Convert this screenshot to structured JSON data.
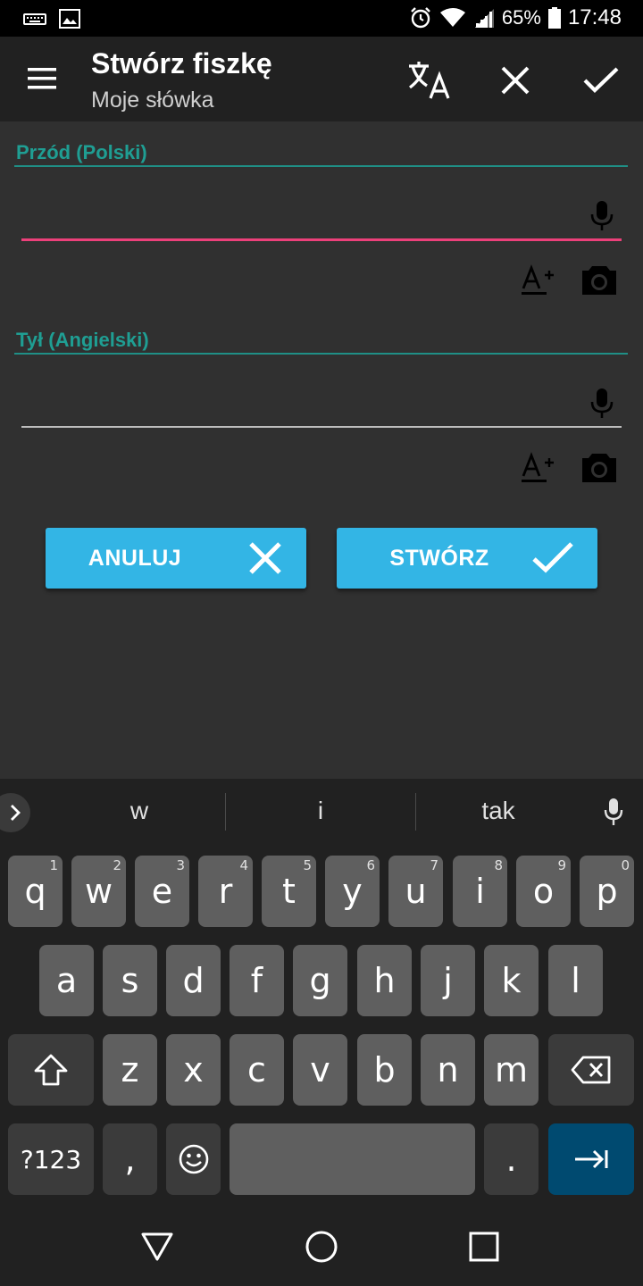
{
  "status_bar": {
    "battery": "65%",
    "time": "17:48",
    "icons": [
      "keyboard-icon",
      "image-icon",
      "alarm-icon",
      "wifi-icon",
      "signal-icon",
      "battery-icon"
    ]
  },
  "app_bar": {
    "title": "Stwórz fiszkę",
    "subtitle": "Moje słówka",
    "icons": [
      "menu-icon",
      "translate-icon",
      "close-icon",
      "check-icon"
    ]
  },
  "front": {
    "label": "Przód (Polski)",
    "value": "",
    "underline_color": "#ec407a"
  },
  "back": {
    "label": "Tył (Angielski)",
    "value": "",
    "underline_color": "#bdbdbd"
  },
  "buttons": {
    "cancel": "ANULUJ",
    "create": "STWÓRZ",
    "color": "#33b5e5"
  },
  "keyboard": {
    "suggestions": [
      "w",
      "i",
      "tak"
    ],
    "row1": [
      {
        "k": "q",
        "h": "1"
      },
      {
        "k": "w",
        "h": "2"
      },
      {
        "k": "e",
        "h": "3"
      },
      {
        "k": "r",
        "h": "4"
      },
      {
        "k": "t",
        "h": "5"
      },
      {
        "k": "y",
        "h": "6"
      },
      {
        "k": "u",
        "h": "7"
      },
      {
        "k": "i",
        "h": "8"
      },
      {
        "k": "o",
        "h": "9"
      },
      {
        "k": "p",
        "h": "0"
      }
    ],
    "row2": [
      "a",
      "s",
      "d",
      "f",
      "g",
      "h",
      "j",
      "k",
      "l"
    ],
    "row3": [
      "z",
      "x",
      "c",
      "v",
      "b",
      "n",
      "m"
    ],
    "symbols_key": "?123",
    "comma_key": ",",
    "period_key": "."
  },
  "nav_bar": {
    "icons": [
      "back-icon",
      "home-icon",
      "recents-icon"
    ]
  }
}
